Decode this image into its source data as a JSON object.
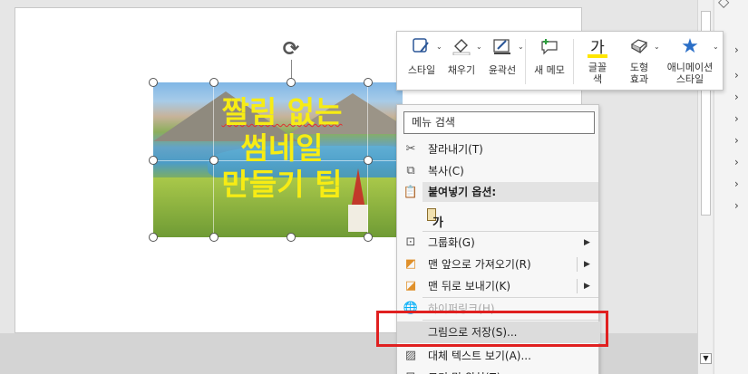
{
  "slide": {
    "title_lines": [
      "짤림 없는",
      "썸네일",
      "만들기 팁"
    ]
  },
  "mini_toolbar": {
    "items": [
      {
        "label": "스타일",
        "icon": "shape-style-icon"
      },
      {
        "label": "채우기",
        "icon": "fill-bucket-icon"
      },
      {
        "label": "윤곽선",
        "icon": "outline-pen-icon"
      },
      {
        "label": "새 메모",
        "icon": "new-comment-icon"
      },
      {
        "label_line1": "글꼴",
        "label_line2": "색",
        "glyph": "가",
        "icon": "font-color-icon",
        "accent": "#ffe600"
      },
      {
        "label_line1": "도형",
        "label_line2": "효과",
        "icon": "shape-effects-icon"
      },
      {
        "label_line1": "애니메이션",
        "label_line2": "스타일",
        "icon": "animation-star-icon",
        "accent": "#2b6fc7"
      }
    ]
  },
  "context_menu": {
    "search_label": "메뉴 검색",
    "items": [
      {
        "label": "잘라내기(T)",
        "icon": "scissors-icon",
        "enabled": true
      },
      {
        "label": "복사(C)",
        "icon": "copy-icon",
        "enabled": true
      },
      {
        "label": "붙여넣기 옵션:",
        "icon": "paste-icon",
        "header": true
      },
      {
        "label": "가",
        "icon": "paste-keep-text-icon"
      },
      {
        "label": "그룹화(G)",
        "icon": "group-icon",
        "submenu": true
      },
      {
        "label": "맨 앞으로 가져오기(R)",
        "icon": "bring-front-icon",
        "submenu": true
      },
      {
        "label": "맨 뒤로 보내기(K)",
        "icon": "send-back-icon",
        "submenu": true
      },
      {
        "label": "하이퍼링크(H)...",
        "icon": "hyperlink-icon",
        "enabled": false
      },
      {
        "label": "그림으로 저장(S)...",
        "icon": "save-picture-icon",
        "highlighted": true
      },
      {
        "label": "대체 텍스트 보기(A)...",
        "icon": "alt-text-icon"
      },
      {
        "label": "크기 및 위치(Z)...",
        "icon": "size-position-icon"
      }
    ]
  },
  "colors": {
    "title_text": "#f7ec14",
    "annotation_box": "#e02020",
    "highlight_row": "#dcdcdc"
  }
}
